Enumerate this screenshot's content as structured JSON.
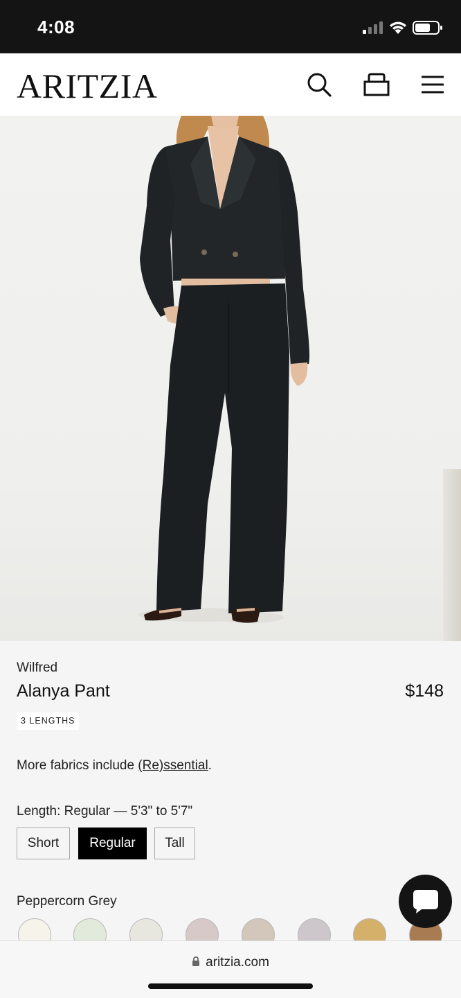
{
  "status_bar": {
    "time": "4:08"
  },
  "header": {
    "logo": "ARITZIA",
    "icons": [
      "search-icon",
      "bag-icon",
      "menu-icon"
    ]
  },
  "product": {
    "brand": "Wilfred",
    "name": "Alanya Pant",
    "price": "$148",
    "badge": "3 LENGTHS",
    "fabrics_prefix": "More fabrics include ",
    "fabrics_link": "(Re)ssential",
    "fabrics_suffix": ".",
    "length_label": "Length: Regular — 5'3\" to 5'7\"",
    "lengths": [
      {
        "label": "Short",
        "selected": false
      },
      {
        "label": "Regular",
        "selected": true
      },
      {
        "label": "Tall",
        "selected": false
      }
    ],
    "color_label": "Peppercorn Grey",
    "swatches": [
      "#f6f3ea",
      "#e2eadb",
      "#e8e7df",
      "#d8c9c9",
      "#d3c6bb",
      "#cdc6cb",
      "#d4b06a",
      "#a87b52"
    ]
  },
  "url_bar": {
    "url": "aritzia.com"
  },
  "colors": {
    "accent": "#000000",
    "status_bar": "#141414"
  }
}
